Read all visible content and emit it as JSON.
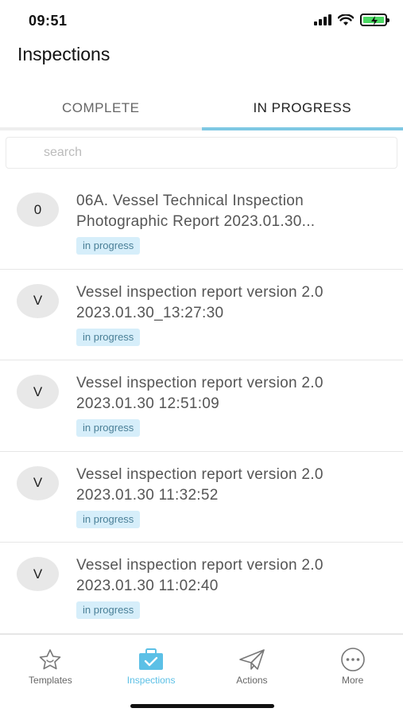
{
  "status_bar": {
    "time": "09:51"
  },
  "header": {
    "title": "Inspections"
  },
  "tabs": [
    {
      "label": "COMPLETE"
    },
    {
      "label": "IN PROGRESS"
    }
  ],
  "search": {
    "placeholder": "search",
    "value": ""
  },
  "inspections": [
    {
      "avatar": "0",
      "title": "06A. Vessel Technical Inspection Photographic Report 2023.01.30...",
      "status": "in progress"
    },
    {
      "avatar": "V",
      "title": "Vessel inspection report version 2.0 2023.01.30_13:27:30",
      "status": "in progress"
    },
    {
      "avatar": "V",
      "title": "Vessel inspection report version 2.0 2023.01.30 12:51:09",
      "status": "in progress"
    },
    {
      "avatar": "V",
      "title": "Vessel inspection report version 2.0 2023.01.30 11:32:52",
      "status": "in progress"
    },
    {
      "avatar": "V",
      "title": "Vessel inspection report version 2.0 2023.01.30 11:02:40",
      "status": "in progress"
    }
  ],
  "bottom_nav": [
    {
      "label": "Templates",
      "icon": "star-icon"
    },
    {
      "label": "Inspections",
      "icon": "briefcase-check-icon"
    },
    {
      "label": "Actions",
      "icon": "paper-plane-icon"
    },
    {
      "label": "More",
      "icon": "more-dots-icon"
    }
  ],
  "colors": {
    "accent": "#5cc0e6",
    "active_tab_underline": "#7ec8e3",
    "badge_bg": "#d6eefa",
    "badge_text": "#4a7f97"
  }
}
